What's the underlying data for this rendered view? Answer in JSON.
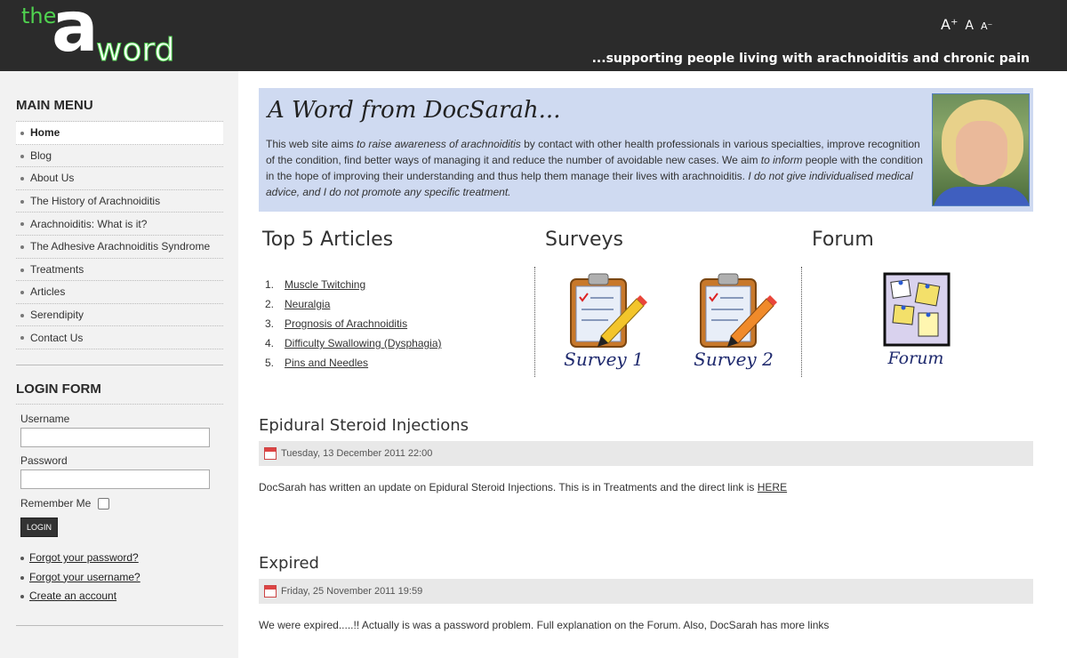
{
  "header": {
    "logo": {
      "the": "the",
      "a": "a",
      "word": "word"
    },
    "font_controls": {
      "increase": "A⁺",
      "default": "A",
      "decrease": "A⁻"
    },
    "tagline": "...supporting people living with arachnoiditis and chronic pain",
    "colors": {
      "bar": "#2b2b2b",
      "logo_green": "#4fd14f"
    }
  },
  "sidebar": {
    "main_menu_title": "MAIN MENU",
    "items": [
      {
        "label": "Home",
        "active": true
      },
      {
        "label": "Blog"
      },
      {
        "label": "About Us"
      },
      {
        "label": "The History of Arachnoiditis"
      },
      {
        "label": "Arachnoiditis: What is it?"
      },
      {
        "label": "The Adhesive Arachnoiditis Syndrome"
      },
      {
        "label": "Treatments"
      },
      {
        "label": "Articles"
      },
      {
        "label": "Serendipity"
      },
      {
        "label": "Contact Us"
      }
    ],
    "login": {
      "title": "LOGIN FORM",
      "username_label": "Username",
      "username_value": "",
      "password_label": "Password",
      "password_value": "",
      "remember_label": "Remember Me",
      "remember_checked": false,
      "login_button": "LOGIN"
    },
    "links": [
      "Forgot your password?",
      "Forgot your username?",
      "Create an account"
    ]
  },
  "banner": {
    "title": "A Word from DocSarah...",
    "text_1": "This web site aims ",
    "text_2": "to raise awareness of arachnoiditis",
    "text_3": " by contact with other health professionals in various specialties, improve recognition of the condition, find better ways of managing it and reduce the number of avoidable new cases. We aim ",
    "text_4": "to inform",
    "text_5": " people with the condition in the hope of improving their understanding and thus help them manage their lives with arachnoiditis. ",
    "text_6": "I do not give individualised medical advice, and I do not promote any specific treatment.",
    "bg_color": "#cfdaf1"
  },
  "top5": {
    "title": "Top 5 Articles",
    "items": [
      {
        "num": "1.",
        "label": "Muscle Twitching"
      },
      {
        "num": "2.",
        "label": "Neuralgia"
      },
      {
        "num": "3.",
        "label": "Prognosis of Arachnoiditis"
      },
      {
        "num": "4.",
        "label": "Difficulty Swallowing (Dysphagia)"
      },
      {
        "num": "5.",
        "label": "Pins and Needles"
      }
    ]
  },
  "surveys": {
    "title": "Surveys",
    "items": [
      {
        "caption": "Survey 1"
      },
      {
        "caption": "Survey 2"
      }
    ]
  },
  "forum": {
    "title": "Forum",
    "caption": "Forum"
  },
  "articles": [
    {
      "title": "Epidural Steroid Injections",
      "date": "Tuesday, 13 December 2011 22:00",
      "body": "DocSarah has written an update on Epidural Steroid Injections. This is in Treatments and the direct link is ",
      "link": "HERE"
    },
    {
      "title": "Expired",
      "date": "Friday, 25 November 2011 19:59",
      "body": "We were expired.....!! Actually is was a password problem. Full explanation on the Forum. Also, DocSarah has more links",
      "link": ""
    }
  ]
}
